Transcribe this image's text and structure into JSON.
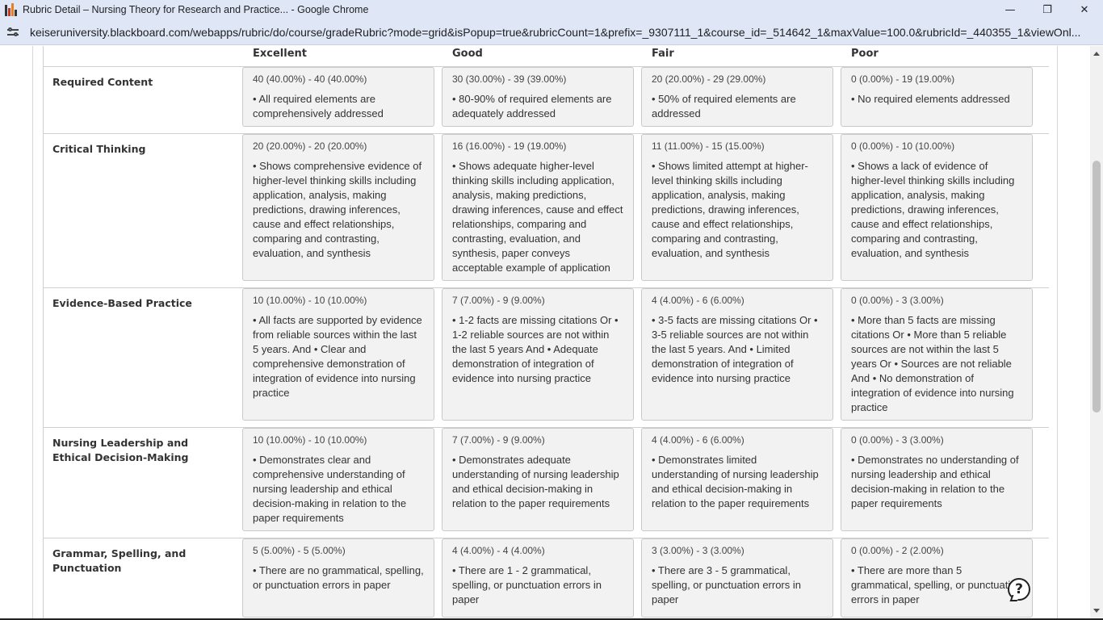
{
  "window": {
    "title": "Rubric Detail – Nursing Theory for Research and Practice... - Google Chrome",
    "controls": {
      "minimize": "—",
      "restore": "❐",
      "close": "✕"
    }
  },
  "address": {
    "url": "keiseruniversity.blackboard.com/webapps/rubric/do/course/gradeRubric?mode=grid&isPopup=true&rubricCount=1&prefix=_9307111_1&course_id=_514642_1&maxValue=100.0&rubricId=_440355_1&viewOnl..."
  },
  "rubric": {
    "levels": [
      "Excellent",
      "Good",
      "Fair",
      "Poor"
    ],
    "rows": [
      {
        "criterion": "Required Content",
        "cells": [
          {
            "points": "40 (40.00%) - 40 (40.00%)",
            "text": "• All required elements are comprehensively addressed"
          },
          {
            "points": "30 (30.00%) - 39 (39.00%)",
            "text": "• 80-90% of required elements are adequately addressed"
          },
          {
            "points": "20 (20.00%) - 29 (29.00%)",
            "text": "• 50% of required elements are addressed"
          },
          {
            "points": "0 (0.00%) - 19 (19.00%)",
            "text": "• No required elements addressed"
          }
        ]
      },
      {
        "criterion": "Critical Thinking",
        "cells": [
          {
            "points": "20 (20.00%) - 20 (20.00%)",
            "text": "• Shows comprehensive evidence of higher-level thinking skills including application, analysis, making predictions, drawing inferences, cause and effect relationships, comparing and contrasting, evaluation, and synthesis"
          },
          {
            "points": "16 (16.00%) - 19 (19.00%)",
            "text": "• Shows adequate higher-level thinking skills including application, analysis, making predictions, drawing inferences, cause and effect relationships, comparing and contrasting, evaluation, and synthesis, paper conveys acceptable example of application"
          },
          {
            "points": "11 (11.00%) - 15 (15.00%)",
            "text": "• Shows limited attempt at higher-level thinking skills including application, analysis, making predictions, drawing inferences, cause and effect relationships, comparing and contrasting, evaluation, and synthesis"
          },
          {
            "points": "0 (0.00%) - 10 (10.00%)",
            "text": "• Shows a lack of evidence of higher-level thinking skills including application, analysis, making predictions, drawing inferences, cause and effect relationships, comparing and contrasting, evaluation, and synthesis"
          }
        ]
      },
      {
        "criterion": "Evidence-Based Practice",
        "cells": [
          {
            "points": "10 (10.00%) - 10 (10.00%)",
            "text": "• All facts are supported by evidence from reliable sources within the last 5 years. And • Clear and comprehensive demonstration of integration of evidence into nursing practice"
          },
          {
            "points": "7 (7.00%) - 9 (9.00%)",
            "text": "• 1-2 facts are missing citations Or • 1-2 reliable sources are not within the last 5 years And • Adequate demonstration of integration of evidence into nursing practice"
          },
          {
            "points": "4 (4.00%) - 6 (6.00%)",
            "text": "• 3-5 facts are missing citations Or • 3-5 reliable sources are not within the last 5 years. And • Limited demonstration of integration of evidence into nursing practice"
          },
          {
            "points": "0 (0.00%) - 3 (3.00%)",
            "text": "• More than 5 facts are missing citations Or • More than 5 reliable sources are not within the last 5 years Or • Sources are not reliable And • No demonstration of integration of evidence into nursing practice"
          }
        ]
      },
      {
        "criterion": "Nursing Leadership and Ethical Decision-Making",
        "cells": [
          {
            "points": "10 (10.00%) - 10 (10.00%)",
            "text": "• Demonstrates clear and comprehensive understanding of nursing leadership and ethical decision-making in relation to the paper requirements"
          },
          {
            "points": "7 (7.00%) - 9 (9.00%)",
            "text": "• Demonstrates adequate understanding of nursing leadership and ethical decision-making in relation to the paper requirements"
          },
          {
            "points": "4 (4.00%) - 6 (6.00%)",
            "text": "• Demonstrates limited understanding of nursing leadership and ethical decision-making in relation to the paper requirements"
          },
          {
            "points": "0 (0.00%) - 3 (3.00%)",
            "text": "• Demonstrates no understanding of nursing leadership and ethical decision-making in relation to the paper requirements"
          }
        ]
      },
      {
        "criterion": "Grammar, Spelling, and Punctuation",
        "cells": [
          {
            "points": "5 (5.00%) - 5 (5.00%)",
            "text": "• There are no grammatical, spelling, or punctuation errors in paper"
          },
          {
            "points": "4 (4.00%) - 4 (4.00%)",
            "text": "• There are 1 - 2 grammatical, spelling, or punctuation errors in paper"
          },
          {
            "points": "3 (3.00%) - 3 (3.00%)",
            "text": "• There are 3 - 5 grammatical, spelling, or punctuation errors in paper"
          },
          {
            "points": "0 (0.00%) - 2 (2.00%)",
            "text": "• There are more than 5 grammatical, spelling, or punctuation errors in paper"
          }
        ]
      }
    ]
  },
  "help": {
    "icon": "help-icon",
    "glyph": "?"
  },
  "icons": {
    "site_info": "tune-icon",
    "app": "chart-bars-icon"
  }
}
